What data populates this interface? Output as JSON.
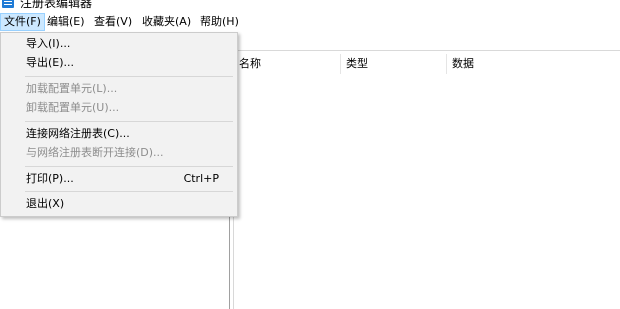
{
  "window": {
    "title": "注册表编辑器",
    "close_glyph": "✕"
  },
  "menubar": {
    "items": [
      {
        "label": "文件(F)"
      },
      {
        "label": "编辑(E)"
      },
      {
        "label": "查看(V)"
      },
      {
        "label": "收藏夹(A)"
      },
      {
        "label": "帮助(H)"
      }
    ]
  },
  "list": {
    "columns": [
      "名称",
      "类型",
      "数据"
    ]
  },
  "file_menu": {
    "items": [
      {
        "label": "导入(I)...",
        "enabled": true
      },
      {
        "label": "导出(E)...",
        "enabled": true
      },
      {
        "label": "加载配置单元(L)...",
        "enabled": false
      },
      {
        "label": "卸载配置单元(U)...",
        "enabled": false
      },
      {
        "label": "连接网络注册表(C)...",
        "enabled": true
      },
      {
        "label": "与网络注册表断开连接(D)...",
        "enabled": false
      },
      {
        "label": "打印(P)...",
        "shortcut": "Ctrl+P",
        "enabled": true
      },
      {
        "label": "退出(X)",
        "enabled": true
      }
    ]
  },
  "colors": {
    "menu_background": "#f2f2f2",
    "active_menu_highlight": "#cce8ff",
    "disabled_text": "#8d8d8d",
    "app_icon": "#1f7bd6"
  }
}
